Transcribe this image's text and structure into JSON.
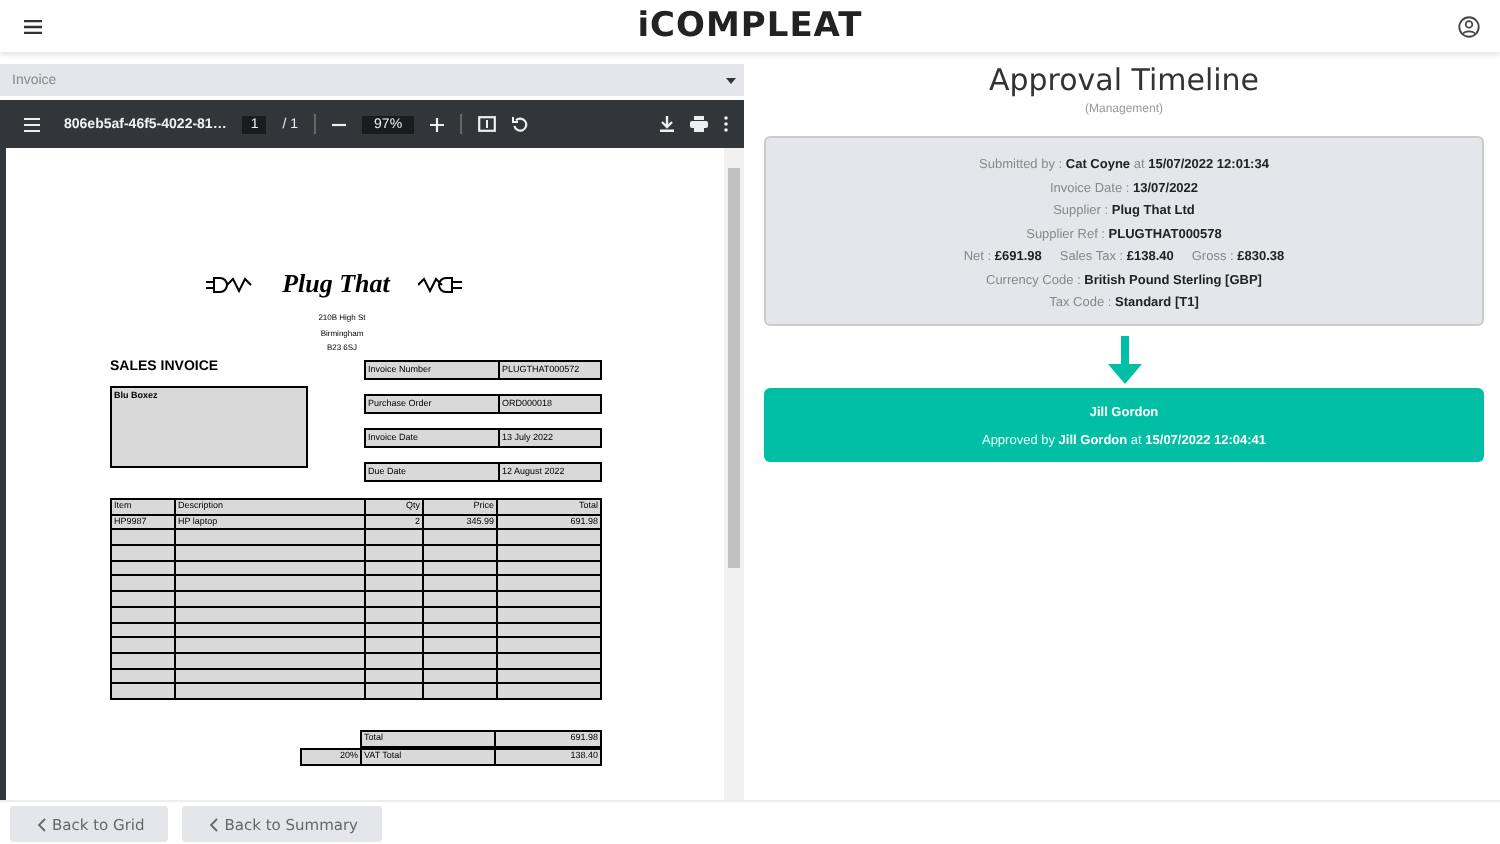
{
  "header": {
    "logo": "iCOMPLEAT"
  },
  "document_selector": {
    "value": "Invoice"
  },
  "pdf_toolbar": {
    "filename": "806eb5af-46f5-4022-81…",
    "page": "1",
    "page_total": "/ 1",
    "zoom": "97%"
  },
  "invoice": {
    "company": "Plug That",
    "address": [
      "210B High St",
      "Birmingham",
      "B23 6SJ"
    ],
    "title": "SALES INVOICE",
    "customer": "Blu Boxez",
    "fields": [
      {
        "label": "Invoice Number",
        "value": "PLUGTHAT000572"
      },
      {
        "label": "Purchase Order",
        "value": "ORD000018"
      },
      {
        "label": "Invoice Date",
        "value": "13 July 2022"
      },
      {
        "label": "Due Date",
        "value": "12 August 2022"
      }
    ],
    "columns": [
      "Item",
      "Description",
      "Qty",
      "Price",
      "Total"
    ],
    "rows": [
      [
        "HP9987",
        "HP laptop",
        "2",
        "345.99",
        "691.98"
      ]
    ],
    "totals": [
      {
        "label": "Total",
        "value": "691.98"
      },
      {
        "rate": "20%",
        "label": "VAT Total",
        "value": "138.40"
      }
    ]
  },
  "timeline": {
    "title": "Approval Timeline",
    "subtitle": "(Management)",
    "submission": [
      [
        "Submitted by : **Cat Coyne** at **15/07/2022 12:01:34**"
      ],
      [
        "Invoice Date : **13/07/2022**"
      ],
      [
        "Supplier : **Plug That Ltd**"
      ],
      [
        "Supplier Ref : **PLUGTHAT000578**"
      ],
      [
        "Net : **£691.98**",
        "Sales Tax : **£138.40**",
        "Gross : **£830.38**"
      ],
      [
        "Currency Code : **British Pound Sterling [GBP]**"
      ],
      [
        "Tax Code : **Standard [T1]**"
      ]
    ],
    "approvals": [
      {
        "name": "Jill Gordon",
        "detail": "Approved by **Jill Gordon** at **15/07/2022 12:04:41**"
      }
    ]
  },
  "buttons": [
    "Back to Grid",
    "Back to Summary"
  ]
}
